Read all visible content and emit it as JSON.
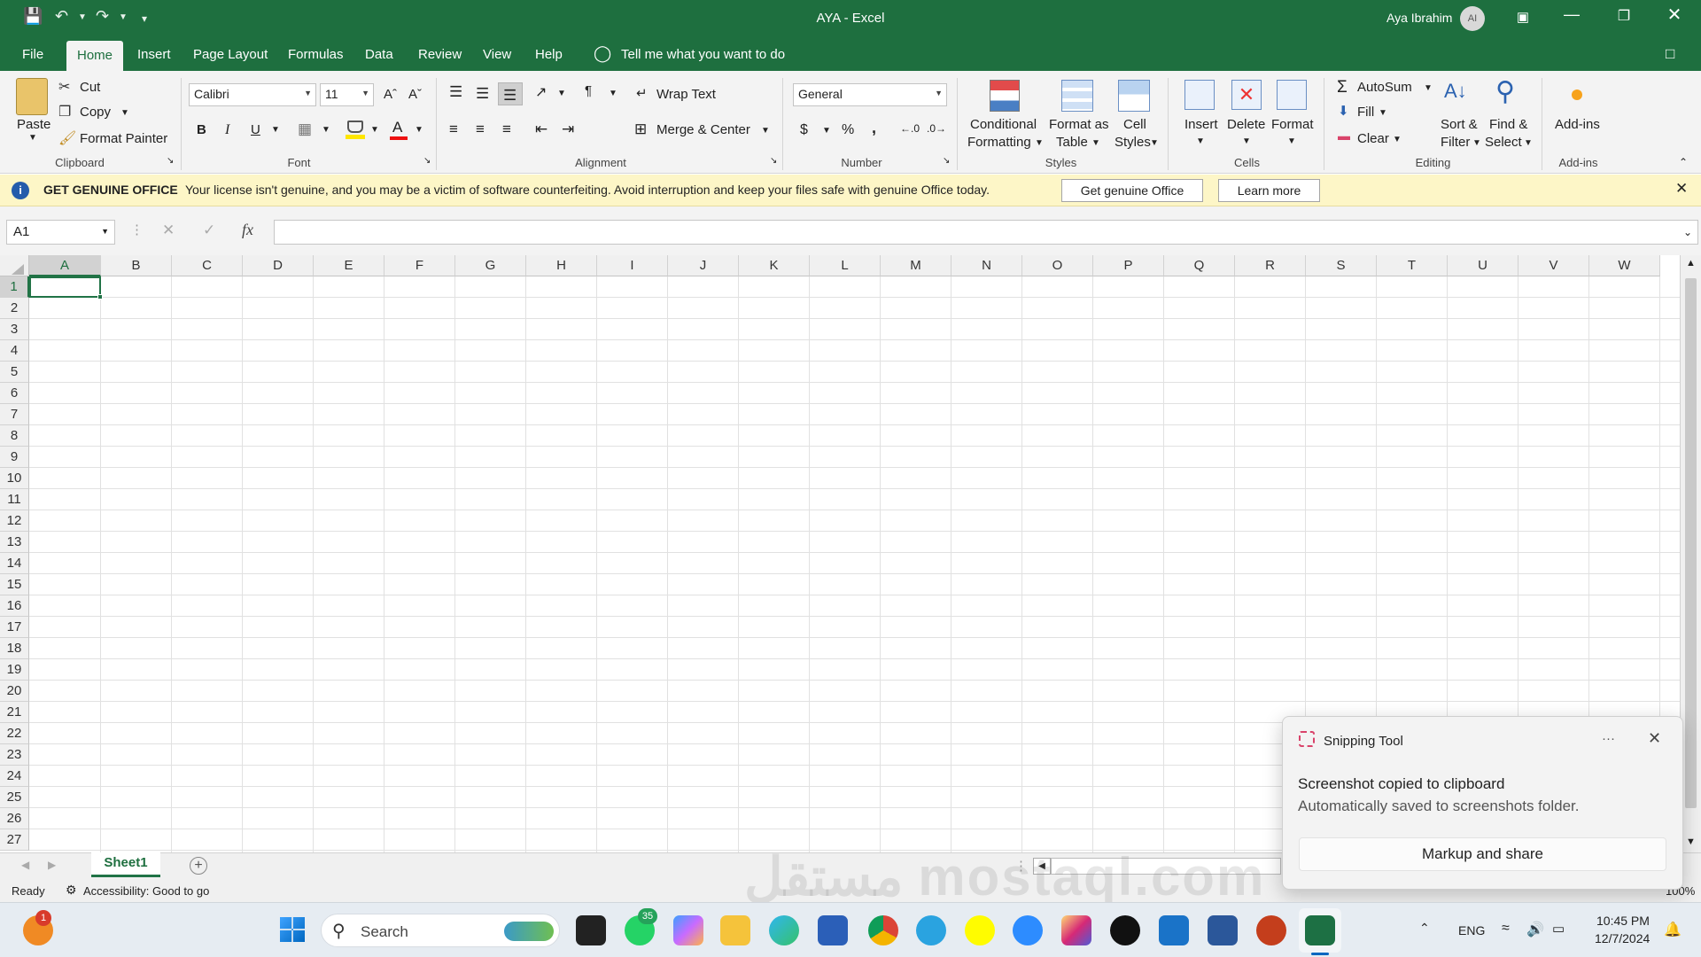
{
  "window": {
    "title": "AYA  -  Excel",
    "user_name": "Aya Ibrahim",
    "user_initials": "AI"
  },
  "tabs": [
    "File",
    "Home",
    "Insert",
    "Page Layout",
    "Formulas",
    "Data",
    "Review",
    "View",
    "Help"
  ],
  "tell_me": "Tell me what you want to do",
  "ribbon": {
    "clipboard": {
      "paste": "Paste",
      "cut": "Cut",
      "copy": "Copy",
      "format_painter": "Format Painter",
      "group": "Clipboard"
    },
    "font": {
      "name": "Calibri",
      "size": "11",
      "bold": "B",
      "italic": "I",
      "underline": "U",
      "group": "Font"
    },
    "alignment": {
      "wrap_text": "Wrap Text",
      "merge_center": "Merge & Center",
      "group": "Alignment"
    },
    "number": {
      "format": "General",
      "currency": "$",
      "percent": "%",
      "comma": ",",
      "group": "Number"
    },
    "styles": {
      "conditional": "Conditional",
      "conditional2": "Formatting",
      "format_as": "Format as",
      "format_as2": "Table",
      "cell": "Cell",
      "cell2": "Styles",
      "group": "Styles"
    },
    "cells": {
      "insert": "Insert",
      "delete": "Delete",
      "format": "Format",
      "group": "Cells"
    },
    "editing": {
      "autosum": "AutoSum",
      "fill": "Fill",
      "clear": "Clear",
      "sort1": "Sort &",
      "sort2": "Filter",
      "find1": "Find &",
      "find2": "Select",
      "group": "Editing"
    },
    "addins": {
      "label": "Add-ins",
      "group": "Add-ins"
    }
  },
  "license_bar": {
    "title": "GET GENUINE OFFICE",
    "message": "Your license isn't genuine, and you may be a victim of software counterfeiting. Avoid interruption and keep your files safe with genuine Office today.",
    "get_button": "Get genuine Office",
    "learn_button": "Learn more"
  },
  "formula_bar": {
    "name_box": "A1",
    "fx": "fx",
    "value": ""
  },
  "columns": [
    "A",
    "B",
    "C",
    "D",
    "E",
    "F",
    "G",
    "H",
    "I",
    "J",
    "K",
    "L",
    "M",
    "N",
    "O",
    "P",
    "Q",
    "R",
    "S",
    "T",
    "U",
    "V",
    "W"
  ],
  "rows": [
    "1",
    "2",
    "3",
    "4",
    "5",
    "6",
    "7",
    "8",
    "9",
    "10",
    "11",
    "12",
    "13",
    "14",
    "15",
    "16",
    "17",
    "18",
    "19",
    "20",
    "21",
    "22",
    "23",
    "24",
    "25",
    "26",
    "27"
  ],
  "sheets": [
    "Sheet1"
  ],
  "status": {
    "ready": "Ready",
    "accessibility": "Accessibility: Good to go",
    "zoom": "100%"
  },
  "toast": {
    "app": "Snipping Tool",
    "more": "···",
    "heading": "Screenshot copied to clipboard",
    "body": "Automatically saved to screenshots folder.",
    "action": "Markup and share"
  },
  "taskbar": {
    "search": "Search",
    "whatsapp_badge": "35",
    "notif_badge": "1",
    "lang": "ENG",
    "time": "10:45 PM",
    "date": "12/7/2024"
  },
  "watermark": "مستقل mostaql.com",
  "colors": {
    "excel_green": "#1e6f3f",
    "license_bg": "#fdf6c7",
    "selection": "#217346"
  }
}
